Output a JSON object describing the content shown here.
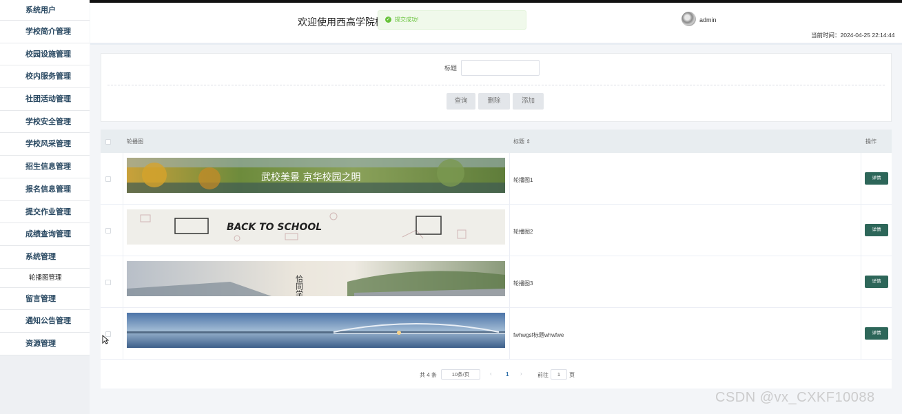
{
  "sidebar": {
    "items": [
      "系统用户",
      "学校简介管理",
      "校园设施管理",
      "校内服务管理",
      "社团活动管理",
      "学校安全管理",
      "学校风采管理",
      "招生信息管理",
      "报名信息管理",
      "提交作业管理",
      "成绩查询管理",
      "系统管理"
    ],
    "sub_item": "轮播图管理",
    "items_after": [
      "留言管理",
      "通知公告管理",
      "资源管理"
    ]
  },
  "header": {
    "title": "欢迎使用西高学院校",
    "toast": "提交成功!",
    "username": "admin",
    "time": "当前时间：2024-04-25 22:14:44"
  },
  "search": {
    "label": "标题",
    "value": "",
    "query_button": "查询",
    "delete_button": "删除",
    "add_button": "添加"
  },
  "table": {
    "headers": {
      "image": "轮播图",
      "title": "标题 ⇕",
      "action": "操作"
    },
    "rows": [
      {
        "title": "轮播图1",
        "banner_text": "武校美景 京华校园之明",
        "detail": "详情"
      },
      {
        "title": "轮播图2",
        "banner_text": "BACK TO SCHOOL",
        "detail": "详情"
      },
      {
        "title": "轮播图3",
        "banner_text": "恰同学少年",
        "detail": "详情"
      },
      {
        "title": "fwhwgsf标题whwfwe",
        "banner_text": "",
        "detail": "详情"
      }
    ]
  },
  "pager": {
    "total": "共 4 条",
    "page_size": "10条/页",
    "current": "1",
    "goto_label": "前往",
    "goto_value": "1",
    "page_suffix": "页"
  },
  "watermark": "CSDN @vx_CXKF10088"
}
